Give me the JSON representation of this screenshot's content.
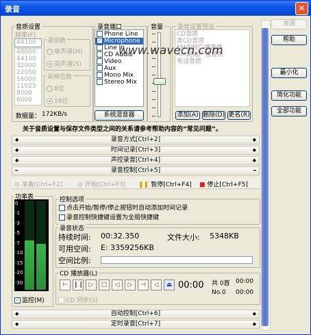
{
  "window": {
    "title": "录音",
    "close_glyph": "✕"
  },
  "right_buttons": {
    "close": "关闭",
    "help": "帮助",
    "minimize": "最小化",
    "simple": "简化功能",
    "full": "全部功能"
  },
  "quality": {
    "group_label": "音质设置",
    "freq_label": "频率(F)",
    "freq_value": "44100",
    "freq_list": [
      "48000",
      "44100",
      "32000",
      "22050",
      "16000",
      "11025",
      "8000",
      "6000"
    ],
    "channel_label": "通道数",
    "mono": "单声道(M)",
    "stereo": "双声道(S)",
    "bits_label": "采样位数",
    "bits8": "8位",
    "bits16": "16位",
    "data_rate_label": "数据量：",
    "data_rate_value": "172KB/s"
  },
  "ports": {
    "group_label": "录音端口",
    "items": [
      {
        "label": "Phone Line",
        "checked": false,
        "selected": false
      },
      {
        "label": "Microphone",
        "checked": true,
        "selected": true
      },
      {
        "label": "Line In",
        "checked": false,
        "selected": false
      },
      {
        "label": "CD Audio",
        "checked": false,
        "selected": false
      },
      {
        "label": "Video",
        "checked": false,
        "selected": false
      },
      {
        "label": "Aux",
        "checked": false,
        "selected": false
      },
      {
        "label": "Mono Mix",
        "checked": false,
        "selected": false
      },
      {
        "label": "Stereo Mix",
        "checked": false,
        "selected": false
      }
    ],
    "mixer_button": "系统混音器"
  },
  "volume": {
    "label": "音量",
    "level": 0.45
  },
  "presets": {
    "group_label": "录音设置预设",
    "items": [
      "CD音质",
      "类CD音质",
      "FM调频广播音质",
      "AM调幅广播音质",
      "电话音质"
    ],
    "add": "添加(A)",
    "delete": "删除(D)",
    "rename": "更名(R)"
  },
  "watermark": "www.wavecn.com",
  "note": "关于音质设置与保存文件类型之间的关系请参考帮助内容的“常见问题”。",
  "sections": {
    "mode": "录音方式[Ctrl+2]",
    "timer": "时间记录[Ctrl+3]",
    "voice": "声控录音[Ctrl+4]",
    "control": "录音控制[Ctrl+5]",
    "auto": "自动控制[Ctrl+6]",
    "timed": "定时录音[Ctrl+7]"
  },
  "transport": {
    "ready": "准备[Ctrl+F2]",
    "start": "开始[Ctrl+F3]",
    "pause": "暂停[Ctrl+F4]",
    "stop": "停止[Ctrl+F5]"
  },
  "meter": {
    "label": "功率表",
    "scale": [
      "0",
      "-1",
      "-3",
      "-5",
      "-7",
      "-10",
      "-15",
      "-20",
      "-30"
    ],
    "monitor": "监控(M)",
    "monitor_checked": true
  },
  "control_options": {
    "group_label": "控制选项",
    "opt1": "点击开始/暂停/停止按钮时自动添加时间记录",
    "opt2": "录音控制快捷键设置为全局快捷键"
  },
  "status": {
    "group_label": "录音状态",
    "duration_label": "持续时间:",
    "duration_value": "00:32.350",
    "filesize_label": "文件大小:",
    "filesize_value": "5348KB",
    "free_label": "可用空间:",
    "free_value": "E: 3359256KB",
    "ratio_label": "空间比例:"
  },
  "cd": {
    "group_label": "CD 播放器(L)",
    "time": "00:00",
    "tracks_label": "共 0首",
    "track_time": "00:00",
    "no_label": "No.0",
    "no_time": "00:00",
    "sync": "CD 同步(S)"
  }
}
